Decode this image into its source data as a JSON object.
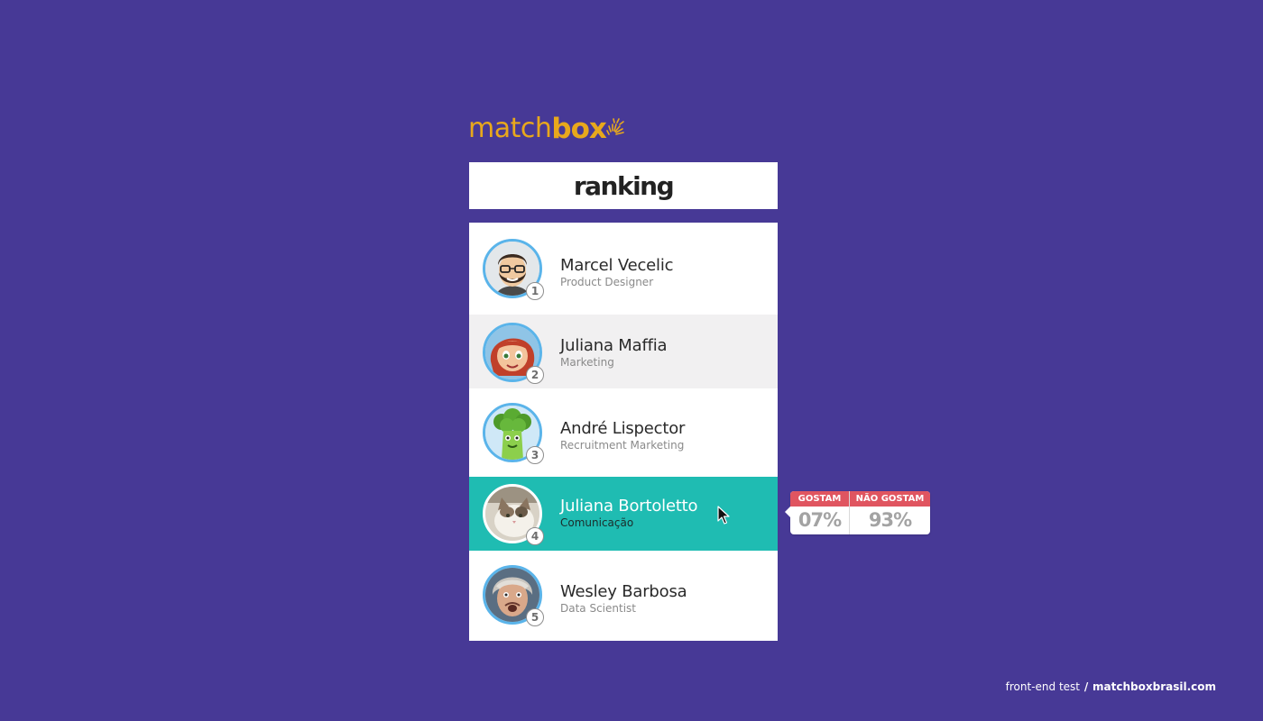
{
  "brand": {
    "logo_match": "match",
    "logo_box": "box",
    "accent_color": "#e8a81c",
    "background_color": "#473996"
  },
  "header": {
    "title": "ranking"
  },
  "ranking": [
    {
      "rank": "1",
      "name": "Marcel Vecelic",
      "role": "Product Designer",
      "avatar": "bearded-man-with-glasses-cartoon"
    },
    {
      "rank": "2",
      "name": "Juliana Maffia",
      "role": "Marketing",
      "avatar": "red-haired-girl-cartoon"
    },
    {
      "rank": "3",
      "name": "André Lispector",
      "role": "Recruitment Marketing",
      "avatar": "broccoli-character"
    },
    {
      "rank": "4",
      "name": "Juliana Bortoletto",
      "role": "Comunicação",
      "avatar": "cat-photo"
    },
    {
      "rank": "5",
      "name": "Wesley Barbosa",
      "role": "Data Scientist",
      "avatar": "older-man-photo"
    }
  ],
  "highlight_color": "#1fbcb2",
  "tooltip": {
    "like_label": "GOSTAM",
    "like_value": "07%",
    "dislike_label": "NÃO GOSTAM",
    "dislike_value": "93%",
    "label_color": "#e05560"
  },
  "footer": {
    "text": "front-end test",
    "separator": "/",
    "site": "matchboxbrasil.com"
  }
}
